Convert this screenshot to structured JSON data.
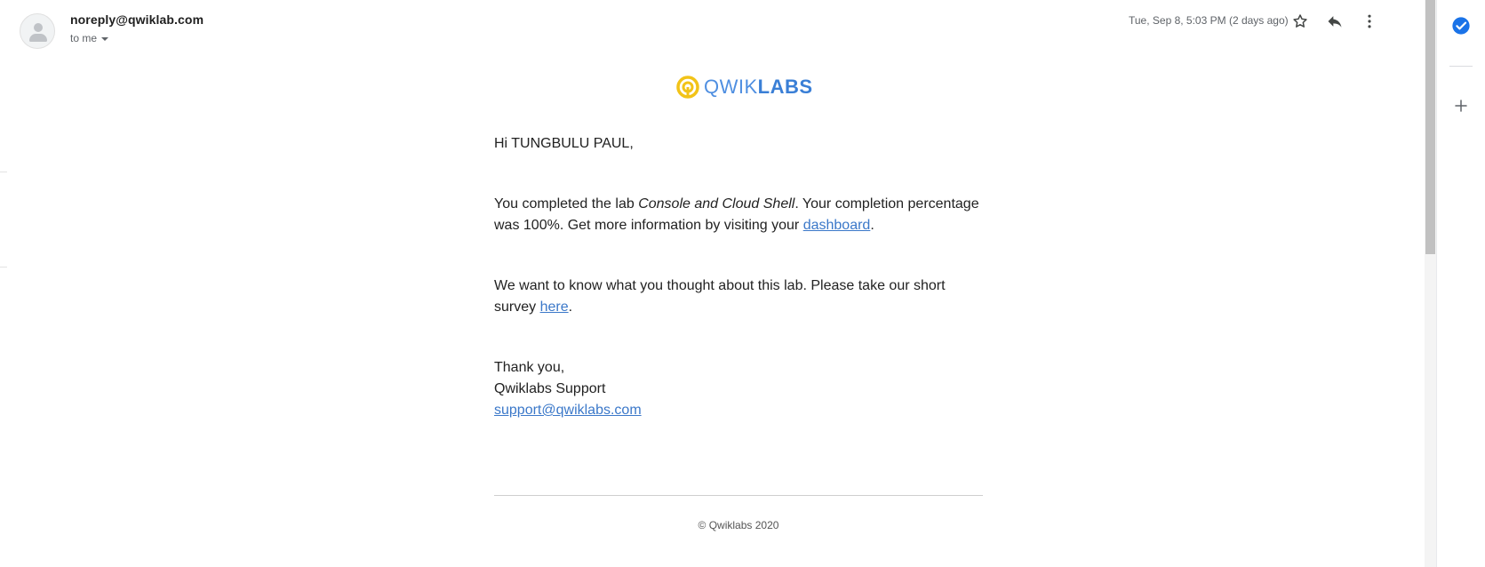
{
  "email": {
    "sender": "noreply@qwiklab.com",
    "recipient_label": "to me",
    "timestamp": "Tue, Sep 8, 5:03 PM (2 days ago)",
    "actions": [
      {
        "name": "star-icon"
      },
      {
        "name": "reply-icon"
      },
      {
        "name": "more-vert-icon"
      }
    ]
  },
  "logo": {
    "text_light": "QWIK",
    "text_bold": "LABS",
    "accent_color": "#f2c318",
    "text_color": "#4f8fe1"
  },
  "body": {
    "greeting": "Hi TUNGBULU PAUL,",
    "p1_before": "You completed the lab ",
    "p1_lab": "Console and Cloud Shell",
    "p1_after": ". Your completion percentage was 100%. Get more information by visiting your ",
    "p1_link": "dashboard",
    "p1_end": ".",
    "p2_before": "We want to know what you thought about this lab. Please take our short survey ",
    "p2_link": "here",
    "p2_end": ".",
    "signoff": "Thank you,",
    "signature": "Qwiklabs Support",
    "support_email": "support@qwiklabs.com"
  },
  "footer": {
    "copyright": "© Qwiklabs 2020"
  },
  "side_panel": {
    "items": [
      {
        "name": "tasks-icon",
        "color": "#1a73e8"
      },
      {
        "name": "add-icon",
        "color": "#5f6368"
      }
    ]
  }
}
